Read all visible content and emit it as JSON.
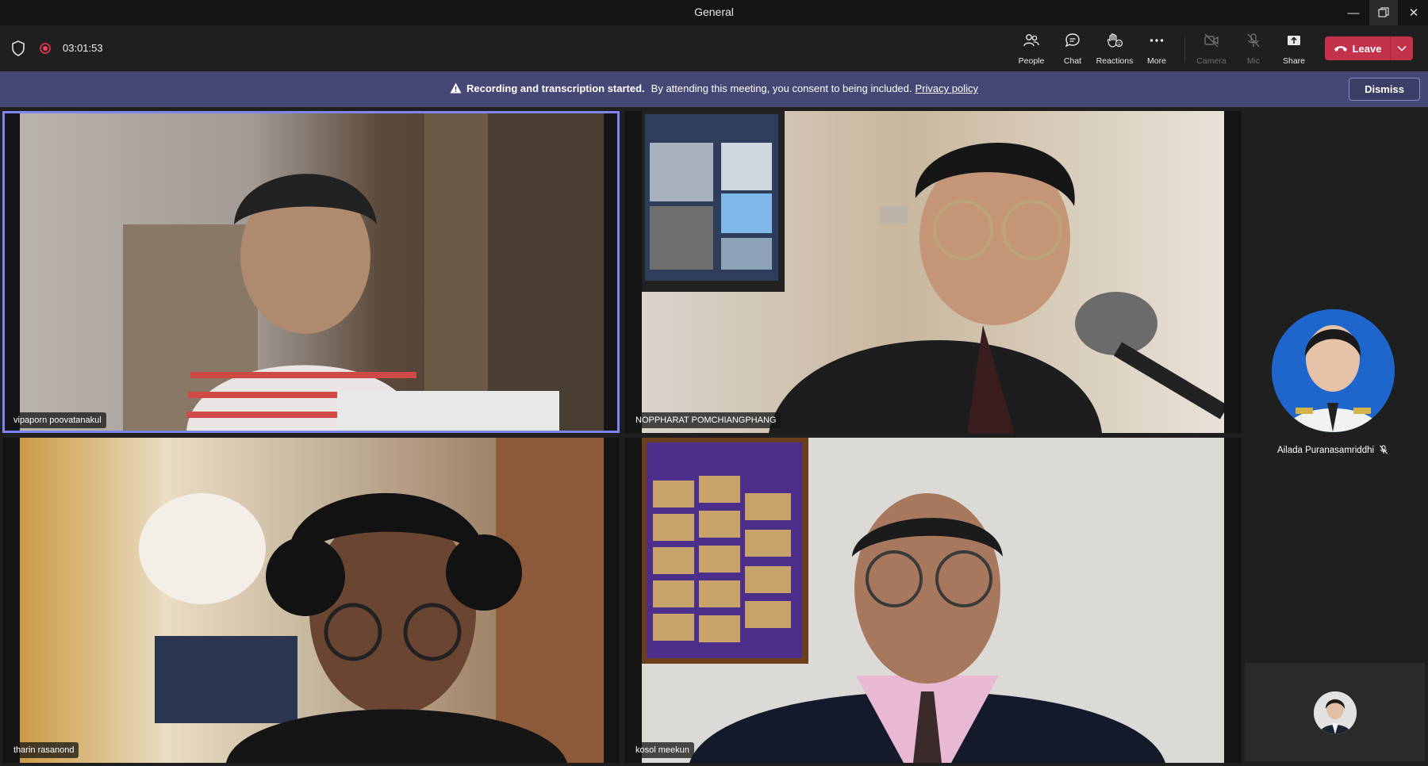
{
  "window": {
    "title": "General"
  },
  "toolbar": {
    "timer": "03:01:53",
    "buttons": {
      "people": "People",
      "chat": "Chat",
      "reactions": "Reactions",
      "more": "More",
      "camera": "Camera",
      "mic": "Mic",
      "share": "Share"
    },
    "leave_label": "Leave"
  },
  "banner": {
    "title": "Recording and transcription started.",
    "message": "By attending this meeting, you consent to being included.",
    "link": "Privacy policy",
    "dismiss": "Dismiss"
  },
  "participants": [
    {
      "name": "vipaporn poovatanakul",
      "active": true
    },
    {
      "name": "NOPPHARAT POMCHIANGPHANG"
    },
    {
      "name": "tharin rasanond"
    },
    {
      "name": "kosol meekun"
    }
  ],
  "side_participant": {
    "name": "Ailada Puranasamriddhi",
    "muted": true
  },
  "colors": {
    "accent": "#7f85f5",
    "leave": "#c4314b",
    "banner": "#464775"
  }
}
